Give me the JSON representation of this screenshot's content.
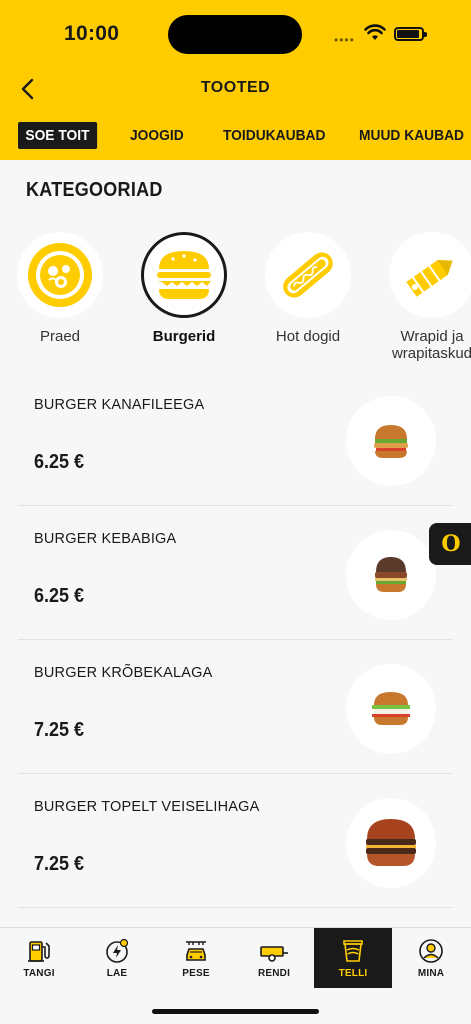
{
  "status_bar": {
    "time": "10:00",
    "signal_dots": "••••"
  },
  "nav": {
    "title": "TOOTED",
    "back_icon": "chevron-left-icon"
  },
  "tabs": [
    {
      "label": "SOE TOIT",
      "active": true
    },
    {
      "label": "JOOGID",
      "active": false
    },
    {
      "label": "TOIDUKAUBAD",
      "active": false
    },
    {
      "label": "MUUD KAUBAD",
      "active": false
    }
  ],
  "categories": {
    "title": "KATEGOORIAD",
    "items": [
      {
        "label": "Praed",
        "icon": "plate-food-icon",
        "selected": false
      },
      {
        "label": "Burgerid",
        "icon": "burger-icon",
        "selected": true
      },
      {
        "label": "Hot dogid",
        "icon": "hotdog-icon",
        "selected": false
      },
      {
        "label": "Wrapid ja wrapitaskud",
        "icon": "wrap-icon",
        "selected": false
      }
    ]
  },
  "products": [
    {
      "name": "BURGER KANAFILEEGA",
      "price": "6.25 €"
    },
    {
      "name": "BURGER KEBABIGA",
      "price": "6.25 €"
    },
    {
      "name": "BURGER KRÕBEKALAGA",
      "price": "7.25 €"
    },
    {
      "name": "BURGER TOPELT VEISELIHAGA",
      "price": "7.25 €"
    }
  ],
  "floating_button": {
    "label": "O"
  },
  "bottom_nav": [
    {
      "label": "TANGI",
      "icon": "fuel-pump-icon",
      "active": false
    },
    {
      "label": "LAE",
      "icon": "ev-charge-icon",
      "active": false
    },
    {
      "label": "PESE",
      "icon": "car-wash-icon",
      "active": false
    },
    {
      "label": "RENDI",
      "icon": "trailer-icon",
      "active": false
    },
    {
      "label": "TELLI",
      "icon": "coffee-order-icon",
      "active": true
    },
    {
      "label": "MINA",
      "icon": "user-icon",
      "active": false
    }
  ],
  "colors": {
    "brand_yellow": "#ffcc00",
    "dark": "#1a1a1a",
    "background": "#f7f7f7"
  }
}
